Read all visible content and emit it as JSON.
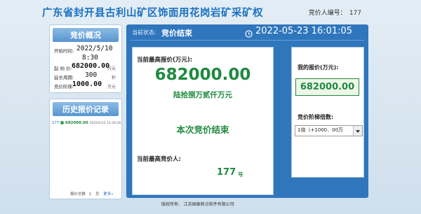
{
  "header": {
    "title": "广东省封开县古利山矿区饰面用花岗岩矿采矿权",
    "bidder_no_label": "竞价人编号：",
    "bidder_no": "177"
  },
  "overview": {
    "title": "竞价概况",
    "start_time_label": "开始时间:",
    "start_date": "2022/5/10",
    "start_clock": "8:30",
    "start_price_label": "起 始 价:",
    "start_price": "682000.00",
    "start_price_unit": "万元",
    "extend_label": "延长周期:",
    "extend_value": "300",
    "extend_unit": "秒",
    "step_label": "竞价阶梯:",
    "step_value": "1000.00",
    "step_unit": "万元"
  },
  "history": {
    "title": "历史报价记录",
    "records": [
      {
        "bidder": "177",
        "price": "682000.00",
        "time": "2022/5/23 15:34:26"
      }
    ],
    "pager": {
      "count_label": "报价总数",
      "count": "1",
      "page_label": "页",
      "next_label": "更多»"
    }
  },
  "status": {
    "label": "当前状态:",
    "value": "竞价结束",
    "datetime": "2022-05-23 16:01:05"
  },
  "current": {
    "high_label": "当前最高报价(万元):",
    "high_value": "682000.00",
    "high_chinese": "陆拾捌万贰仟万元",
    "end_message": "本次竞价结束",
    "bidder_label": "当前最高竞价人:",
    "bidder_no": "177",
    "bidder_suffix": "号"
  },
  "my_bid": {
    "label": "我的报价(万元):",
    "value": "682000.00",
    "multiplier_label": "竞价阶梯倍数:",
    "multiplier_selected": "1倍（+1000．00万"
  },
  "footer": {
    "copyright": "版权所有:   江苏国泰新点软件有限公司"
  },
  "colors": {
    "title_blue": "#1b70c0",
    "panel_blue": "#2f76bd",
    "header_blue": "#5796cf",
    "green": "#1f8a3f"
  }
}
